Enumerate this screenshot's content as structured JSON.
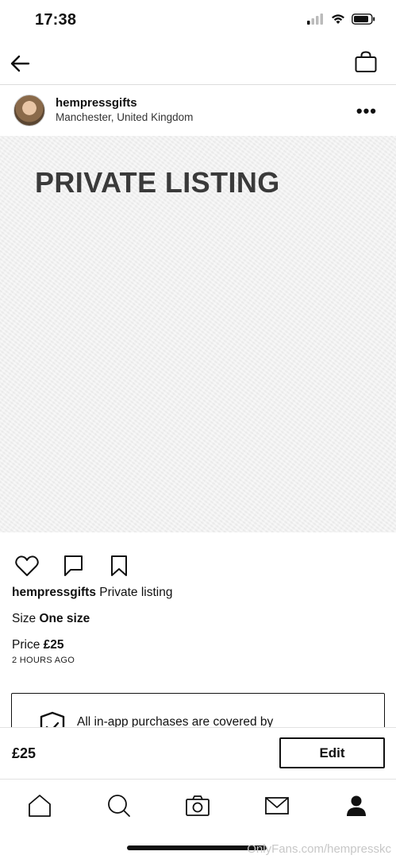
{
  "status": {
    "time": "17:38"
  },
  "header": {
    "username": "hempressgifts",
    "location": "Manchester, United Kingdom",
    "more_glyph": "•••"
  },
  "image": {
    "overlay_text": "PRIVATE LISTING"
  },
  "post": {
    "caption_user": "hempressgifts",
    "caption_text": "Private listing",
    "size_label": "Size",
    "size_value": "One size",
    "price_label": "Price",
    "price_value": "£25",
    "posted": "2 HOURS AGO"
  },
  "protection": {
    "text": "All in-app purchases are covered by"
  },
  "buybar": {
    "price": "£25",
    "edit_label": "Edit"
  },
  "watermark": "OnlyFans.com/hempresskc",
  "icons": [
    "back-arrow-icon",
    "shopping-bag-icon",
    "heart-icon",
    "comment-icon",
    "bookmark-icon",
    "shield-check-icon",
    "home-icon",
    "search-icon",
    "camera-icon",
    "mail-icon",
    "profile-icon"
  ]
}
